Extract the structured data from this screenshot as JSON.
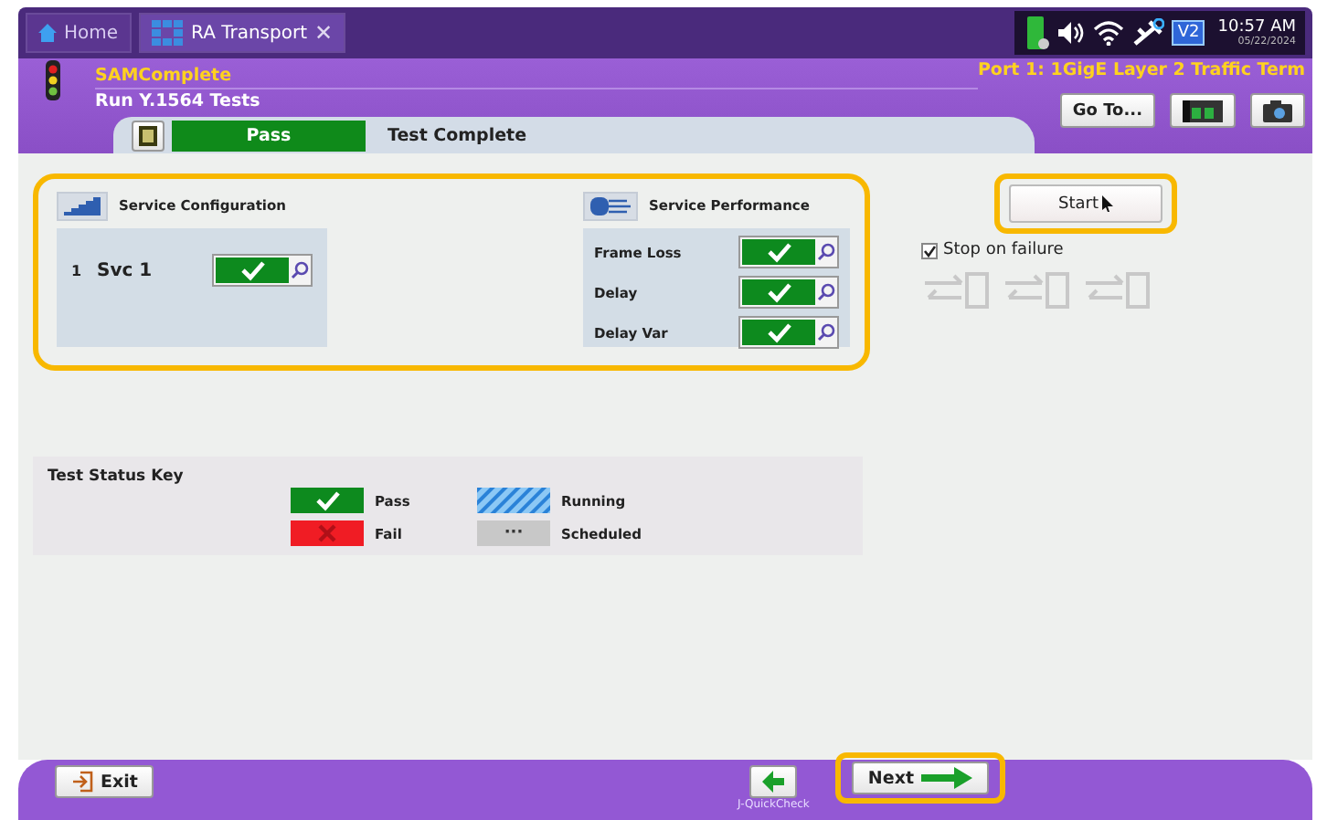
{
  "tabs": [
    {
      "label": "Home",
      "kind": "home",
      "selected": false
    },
    {
      "label": "RA Transport",
      "kind": "app",
      "selected": true,
      "close": "✕"
    }
  ],
  "status_tray": {
    "time": "10:57 AM",
    "date": "05/22/2024",
    "badge": "V2"
  },
  "header": {
    "app_title": "SAMComplete",
    "subtitle": "Run Y.1564 Tests",
    "port": "Port 1: 1GigE Layer 2 Traffic Term",
    "goto_button": "Go To..."
  },
  "result_strip": {
    "result": "Pass",
    "kind": "pass",
    "message": "Test Complete"
  },
  "service_configuration": {
    "title": "Service Configuration",
    "services": [
      {
        "index": "1",
        "name": "Svc 1",
        "kind": "pass"
      }
    ]
  },
  "service_performance": {
    "title": "Service Performance",
    "metrics": [
      {
        "name": "Frame Loss",
        "kind": "pass"
      },
      {
        "name": "Delay",
        "kind": "pass"
      },
      {
        "name": "Delay Var",
        "kind": "pass"
      }
    ]
  },
  "start_button": "Start",
  "stop_on_failure": {
    "label": "Stop on failure",
    "checked": true
  },
  "status_key": {
    "title": "Test Status Key",
    "items": [
      {
        "kind": "pass",
        "label": "Pass"
      },
      {
        "kind": "running",
        "label": "Running"
      },
      {
        "kind": "fail",
        "label": "Fail"
      },
      {
        "kind": "scheduled",
        "label": "Scheduled",
        "symbol": "···"
      }
    ]
  },
  "footer": {
    "exit_button": "Exit",
    "back_caption": "J-QuickCheck",
    "next_button": "Next"
  }
}
